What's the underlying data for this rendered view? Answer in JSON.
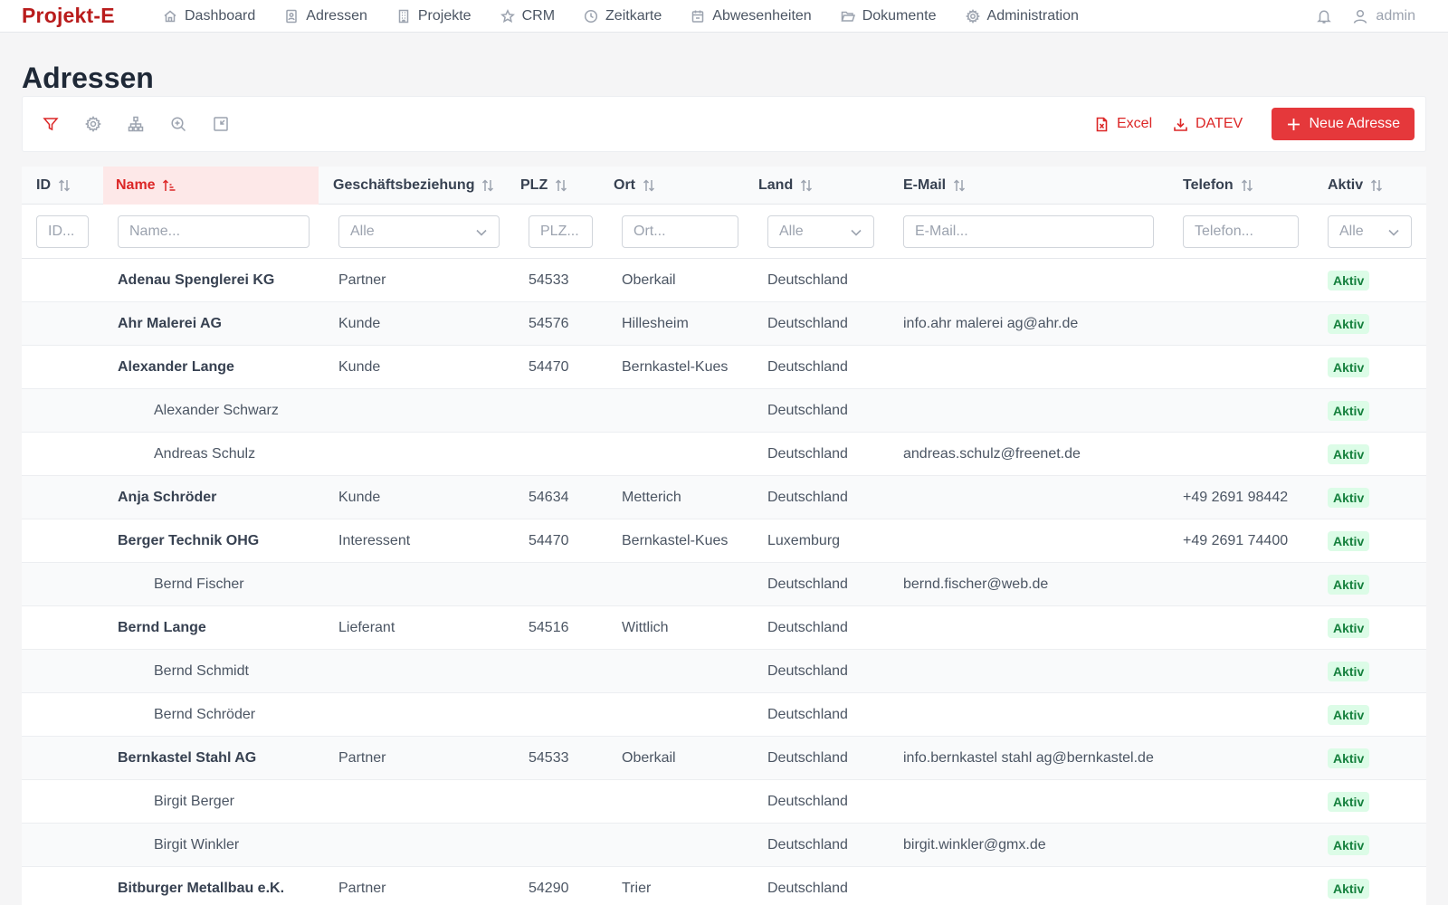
{
  "app": {
    "logo": "Projekt-E",
    "user": "admin"
  },
  "nav": [
    {
      "label": "Dashboard",
      "icon": "home-icon"
    },
    {
      "label": "Adressen",
      "icon": "address-book-icon"
    },
    {
      "label": "Projekte",
      "icon": "building-icon"
    },
    {
      "label": "CRM",
      "icon": "star-icon"
    },
    {
      "label": "Zeitkarte",
      "icon": "clock-icon"
    },
    {
      "label": "Abwesenheiten",
      "icon": "calendar-icon"
    },
    {
      "label": "Dokumente",
      "icon": "folder-icon"
    },
    {
      "label": "Administration",
      "icon": "gear-icon"
    }
  ],
  "page": {
    "title": "Adressen"
  },
  "toolbar": {
    "excel_label": "Excel",
    "datev_label": "DATEV",
    "new_label": "Neue Adresse"
  },
  "columns": {
    "id": "ID",
    "name": "Name",
    "relation": "Geschäftsbeziehung",
    "plz": "PLZ",
    "ort": "Ort",
    "land": "Land",
    "email": "E-Mail",
    "phone": "Telefon",
    "active": "Aktiv"
  },
  "filters": {
    "id_placeholder": "ID...",
    "name_placeholder": "Name...",
    "relation_value": "Alle",
    "plz_placeholder": "PLZ...",
    "ort_placeholder": "Ort...",
    "land_value": "Alle",
    "email_placeholder": "E-Mail...",
    "phone_placeholder": "Telefon...",
    "active_value": "Alle"
  },
  "sort": {
    "column": "name",
    "direction": "asc"
  },
  "colors": {
    "brand": "#b91c1c",
    "accent": "#e5383b",
    "active_badge_bg": "#dcfce7",
    "active_badge_text": "#15803d"
  },
  "rows": [
    {
      "name": "Adenau Spenglerei KG",
      "child": false,
      "relation": "Partner",
      "plz": "54533",
      "ort": "Oberkail",
      "land": "Deutschland",
      "email": "",
      "phone": "",
      "status": "Aktiv"
    },
    {
      "name": "Ahr Malerei AG",
      "child": false,
      "relation": "Kunde",
      "plz": "54576",
      "ort": "Hillesheim",
      "land": "Deutschland",
      "email": "info.ahr malerei ag@ahr.de",
      "phone": "",
      "status": "Aktiv"
    },
    {
      "name": "Alexander Lange",
      "child": false,
      "relation": "Kunde",
      "plz": "54470",
      "ort": "Bernkastel-Kues",
      "land": "Deutschland",
      "email": "",
      "phone": "",
      "status": "Aktiv"
    },
    {
      "name": "Alexander Schwarz",
      "child": true,
      "relation": "",
      "plz": "",
      "ort": "",
      "land": "Deutschland",
      "email": "",
      "phone": "",
      "status": "Aktiv"
    },
    {
      "name": "Andreas Schulz",
      "child": true,
      "relation": "",
      "plz": "",
      "ort": "",
      "land": "Deutschland",
      "email": "andreas.schulz@freenet.de",
      "phone": "",
      "status": "Aktiv"
    },
    {
      "name": "Anja Schröder",
      "child": false,
      "relation": "Kunde",
      "plz": "54634",
      "ort": "Metterich",
      "land": "Deutschland",
      "email": "",
      "phone": "+49 2691 98442",
      "status": "Aktiv"
    },
    {
      "name": "Berger Technik OHG",
      "child": false,
      "relation": "Interessent",
      "plz": "54470",
      "ort": "Bernkastel-Kues",
      "land": "Luxemburg",
      "email": "",
      "phone": "+49 2691 74400",
      "status": "Aktiv"
    },
    {
      "name": "Bernd Fischer",
      "child": true,
      "relation": "",
      "plz": "",
      "ort": "",
      "land": "Deutschland",
      "email": "bernd.fischer@web.de",
      "phone": "",
      "status": "Aktiv"
    },
    {
      "name": "Bernd Lange",
      "child": false,
      "relation": "Lieferant",
      "plz": "54516",
      "ort": "Wittlich",
      "land": "Deutschland",
      "email": "",
      "phone": "",
      "status": "Aktiv"
    },
    {
      "name": "Bernd Schmidt",
      "child": true,
      "relation": "",
      "plz": "",
      "ort": "",
      "land": "Deutschland",
      "email": "",
      "phone": "",
      "status": "Aktiv"
    },
    {
      "name": "Bernd Schröder",
      "child": true,
      "relation": "",
      "plz": "",
      "ort": "",
      "land": "Deutschland",
      "email": "",
      "phone": "",
      "status": "Aktiv"
    },
    {
      "name": "Bernkastel Stahl AG",
      "child": false,
      "relation": "Partner",
      "plz": "54533",
      "ort": "Oberkail",
      "land": "Deutschland",
      "email": "info.bernkastel stahl ag@bernkastel.de",
      "phone": "",
      "status": "Aktiv"
    },
    {
      "name": "Birgit Berger",
      "child": true,
      "relation": "",
      "plz": "",
      "ort": "",
      "land": "Deutschland",
      "email": "",
      "phone": "",
      "status": "Aktiv"
    },
    {
      "name": "Birgit Winkler",
      "child": true,
      "relation": "",
      "plz": "",
      "ort": "",
      "land": "Deutschland",
      "email": "birgit.winkler@gmx.de",
      "phone": "",
      "status": "Aktiv"
    },
    {
      "name": "Bitburger Metallbau e.K.",
      "child": false,
      "relation": "Partner",
      "plz": "54290",
      "ort": "Trier",
      "land": "Deutschland",
      "email": "",
      "phone": "",
      "status": "Aktiv"
    }
  ]
}
